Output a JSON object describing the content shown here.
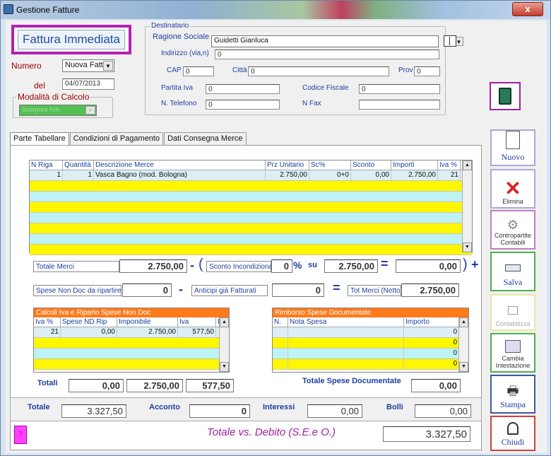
{
  "window": {
    "title": "Gestione Fatture",
    "close_label": "x"
  },
  "header": {
    "doc_type": "Fattura Immediata",
    "numero_label": "Numero",
    "numero_value": "Nuova Fatt",
    "del_label": "del",
    "date_value": "04/07/2013",
    "modalita_label": "Modalità di Calcolo",
    "modalita_value": "Scorporo IVA"
  },
  "destinatario": {
    "group_label": "Destinatario",
    "ragione_label": "Ragione Sociale",
    "ragione_value": "Guidetti Gianluca",
    "indirizzo_label": "Indirizzo (via,n)",
    "indirizzo_value": "0",
    "cap_label": "CAP",
    "cap_value": "0",
    "citta_label": "Città",
    "citta_value": "0",
    "prov_label": "Prov",
    "prov_value": "0",
    "piva_label": "Partita Iva",
    "piva_value": "0",
    "cf_label": "Codice Fiscale",
    "cf_value": "0",
    "tel_label": "N. Telefono",
    "tel_value": "0",
    "fax_label": "N Fax",
    "fax_value": ""
  },
  "tabs": [
    "Parte Tabellare",
    "Condizioni di Pagamento",
    "Dati Consegna Merce"
  ],
  "righe": {
    "columns": [
      "N Riga",
      "Quantità",
      "Descrizione Merce",
      "Prz Unitario",
      "Sc%",
      "Sconto",
      "Importi",
      "Iva %"
    ],
    "rows": [
      {
        "n": "1",
        "qta": "1",
        "desc": "Vasca Bagno (mod. Bologna)",
        "prz": "2.750,00",
        "sc": "0+0",
        "sconto": "0,00",
        "importo": "2.750,00",
        "iva": "21"
      }
    ]
  },
  "totali_merci": {
    "totale_merci_label": "Totale Merci",
    "totale_merci_value": "2.750,00",
    "minus": "-",
    "paren_open": "(",
    "sconto_incond_label": "Sconto Incondizionato",
    "sconto_pct_value": "0",
    "pct_sign": "%",
    "su_label": "su",
    "su_value": "2.750,00",
    "equals": "=",
    "sconto_result": "0,00",
    "paren_close": ")",
    "plus": "+",
    "spese_nondoc_label": "Spese Non Doc da ripartire",
    "spese_nondoc_value": "0",
    "anticipi_label": "Anticipi già Fatturati",
    "anticipi_value": "0",
    "tot_merci_netto_label": "Tot Merci (Netto)",
    "tot_merci_netto_value": "2.750,00"
  },
  "calcoli_iva": {
    "title": "Calcoli Iva e Riparto Spese Non Doc",
    "columns": [
      "Iva %",
      "Spese ND Rip",
      "Imponibile",
      "Iva",
      "I"
    ],
    "rows": [
      {
        "iva_pct": "21",
        "spese": "0,00",
        "imponibile": "2.750,00",
        "iva": "577,50"
      }
    ]
  },
  "rimborso": {
    "title": "Rimborso Spese Documentate",
    "columns": [
      "N.",
      "Nota Spesa",
      "Importo"
    ],
    "importi": [
      "0",
      "0",
      "0",
      "0",
      "0"
    ]
  },
  "totali_row": {
    "label": "Totali",
    "spese": "0,00",
    "imponibile": "2.750,00",
    "iva": "577,50",
    "tot_spese_doc_label": "Totale Spese Documentate",
    "tot_spese_doc_value": "0,00"
  },
  "footer": {
    "totale_label": "Totale",
    "totale_value": "3.327,50",
    "acconto_label": "Acconto",
    "acconto_value": "0",
    "interessi_label": "Interessi",
    "interessi_value": "0,00",
    "bolli_label": "Bolli",
    "bolli_value": "0,00",
    "debito_label": "Totale vs. Debito (S.E.e O.)",
    "debito_value": "3.327,50",
    "help_label": "?"
  },
  "side_buttons": {
    "nuovo": "Nuovo",
    "elimina": "Elimina",
    "contropartite": "Contropartite Contabili",
    "salva": "Salva",
    "contabilizza": "Contabilizza",
    "cambia": "Cambia Intestazione",
    "stampa": "Stampa",
    "chiudi": "Chiudi"
  },
  "colors": {
    "accent_purple": "#b420b4",
    "row_yellow": "#fff700",
    "row_cyan": "#bff2f5",
    "orange_header": "#ff7a1a",
    "label_blue": "#1e3fa0"
  }
}
